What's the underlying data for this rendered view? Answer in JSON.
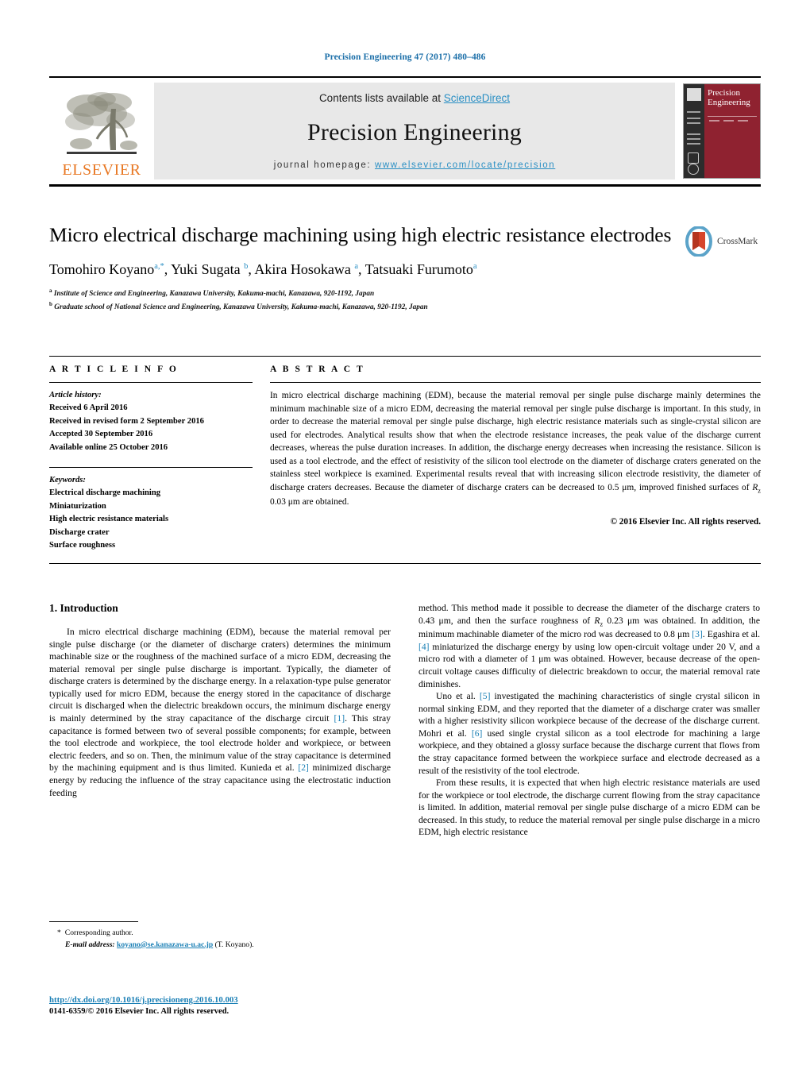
{
  "running_head": "Precision Engineering 47 (2017) 480–486",
  "masthead": {
    "contents_prefix": "Contents lists available at ",
    "sciencedirect": "ScienceDirect",
    "journal_name": "Precision Engineering",
    "homepage_prefix": "journal homepage: ",
    "homepage_url": "www.elsevier.com/locate/precision",
    "publisher_logo_text": "ELSEVIER",
    "cover_title_line1": "Precision",
    "cover_title_line2": "Engineering",
    "accent_link_color": "#2a8fc4",
    "elsevier_orange": "#e87722",
    "cover_red": "#8f2230"
  },
  "article": {
    "title": "Micro electrical discharge machining using high electric resistance electrodes",
    "crossmark_label": "CrossMark",
    "authors_html": "Tomohiro Koyano<sup>a,*</sup>, Yuki Sugata <sup>b</sup>, Akira Hosokawa <sup>a</sup>, Tatsuaki Furumoto<sup>a</sup>",
    "affiliations": [
      "Institute of Science and Engineering, Kanazawa University, Kakuma-machi, Kanazawa, 920-1192, Japan",
      "Graduate school of National Science and Engineering, Kanazawa University, Kakuma-machi, Kanazawa, 920-1192, Japan"
    ],
    "affiliation_marks": [
      "a",
      "b"
    ]
  },
  "article_info": {
    "heading": "A R T I C L E   I N F O",
    "history_label": "Article history:",
    "history": [
      "Received 6 April 2016",
      "Received in revised form 2 September 2016",
      "Accepted 30 September 2016",
      "Available online 25 October 2016"
    ],
    "keywords_label": "Keywords:",
    "keywords": [
      "Electrical discharge machining",
      "Miniaturization",
      "High electric resistance materials",
      "Discharge crater",
      "Surface roughness"
    ]
  },
  "abstract": {
    "heading": "A B S T R A C T",
    "body_part1": "In micro electrical discharge machining (EDM), because the material removal per single pulse discharge mainly determines the minimum machinable size of a micro EDM, decreasing the material removal per single pulse discharge is important. In this study, in order to decrease the material removal per single pulse discharge, high electric resistance materials such as single-crystal silicon are used for electrodes. Analytical results show that when the electrode resistance increases, the peak value of the discharge current decreases, whereas the pulse duration increases. In addition, the discharge energy decreases when increasing the resistance. Silicon is used as a tool electrode, and the effect of resistivity of the silicon tool electrode on the diameter of discharge craters generated on the stainless steel workpiece is examined. Experimental results reveal that with increasing silicon electrode resistivity, the diameter of discharge craters decreases. Because the diameter of discharge craters can be decreased to 0.5 μm, improved finished surfaces of ",
    "body_symbol": "R",
    "body_symbol_sub": "z",
    "body_part2": " 0.03 μm are obtained.",
    "copyright": "© 2016 Elsevier Inc. All rights reserved."
  },
  "introduction": {
    "heading": "1.  Introduction",
    "left_paragraph_1_a": "In micro electrical discharge machining (EDM), because the material removal per single pulse discharge (or the diameter of discharge craters) determines the minimum machinable size or the roughness of the machined surface of a micro EDM, decreasing the material removal per single pulse discharge is important. Typically, the diameter of discharge craters is determined by the discharge energy. In a relaxation-type pulse generator typically used for micro EDM, because the energy stored in the capacitance of discharge circuit is discharged when the dielectric breakdown occurs, the minimum discharge energy is mainly determined by the stray capacitance of the discharge circuit ",
    "ref1": "[1]",
    "left_paragraph_1_b": ". This stray capacitance is formed between two of several possible components; for example, between the tool electrode and workpiece, the tool electrode holder and workpiece, or between electric feeders, and so on. Then, the minimum value of the stray capacitance is determined by the machining equipment and is thus limited. Kunieda et al. ",
    "ref2": "[2]",
    "left_paragraph_1_c": " minimized discharge energy by reducing the influence of the stray capacitance using the electrostatic induction feeding ",
    "right_paragraph_1_a": "method. This method made it possible to decrease the diameter of the discharge craters to 0.43 μm, and then the surface roughness of ",
    "right_rz_symbol": "R",
    "right_rz_sub": "z",
    "right_paragraph_1_b": " 0.23 μm was obtained. In addition, the minimum machinable diameter of the micro rod was decreased to 0.8 μm ",
    "ref3": "[3]",
    "right_paragraph_1_c": ". Egashira et al. ",
    "ref4": "[4]",
    "right_paragraph_1_d": " miniaturized the discharge energy by using low open-circuit voltage under 20 V, and a micro rod with a diameter of 1 μm was obtained. However, because decrease of the open-circuit voltage causes difficulty of dielectric breakdown to occur, the material removal rate diminishes.",
    "right_paragraph_2_a": "Uno et al. ",
    "ref5": "[5]",
    "right_paragraph_2_b": " investigated the machining characteristics of single crystal silicon in normal sinking EDM, and they reported that the diameter of a discharge crater was smaller with a higher resistivity silicon workpiece because of the decrease of the discharge current. Mohri et al. ",
    "ref6": "[6]",
    "right_paragraph_2_c": " used single crystal silicon as a tool electrode for machining a large workpiece, and they obtained a glossy surface because the discharge current that flows from the stray capacitance formed between the workpiece surface and electrode decreased as a result of the resistivity of the tool electrode.",
    "right_paragraph_3": "From these results, it is expected that when high electric resistance materials are used for the workpiece or tool electrode, the discharge current flowing from the stray capacitance is limited. In addition, material removal per single pulse discharge of a micro EDM can be decreased. In this study, to reduce the material removal per single pulse discharge in a micro EDM, high electric resistance"
  },
  "footer": {
    "corresponding_star": "*",
    "corresponding_label": "Corresponding author.",
    "email_label": "E-mail address:",
    "email": "koyano@se.kanazawa-u.ac.jp",
    "email_suffix": "(T. Koyano).",
    "doi_url": "http://dx.doi.org/10.1016/j.precisioneng.2016.10.003",
    "issn_line": "0141-6359/© 2016 Elsevier Inc. All rights reserved."
  }
}
